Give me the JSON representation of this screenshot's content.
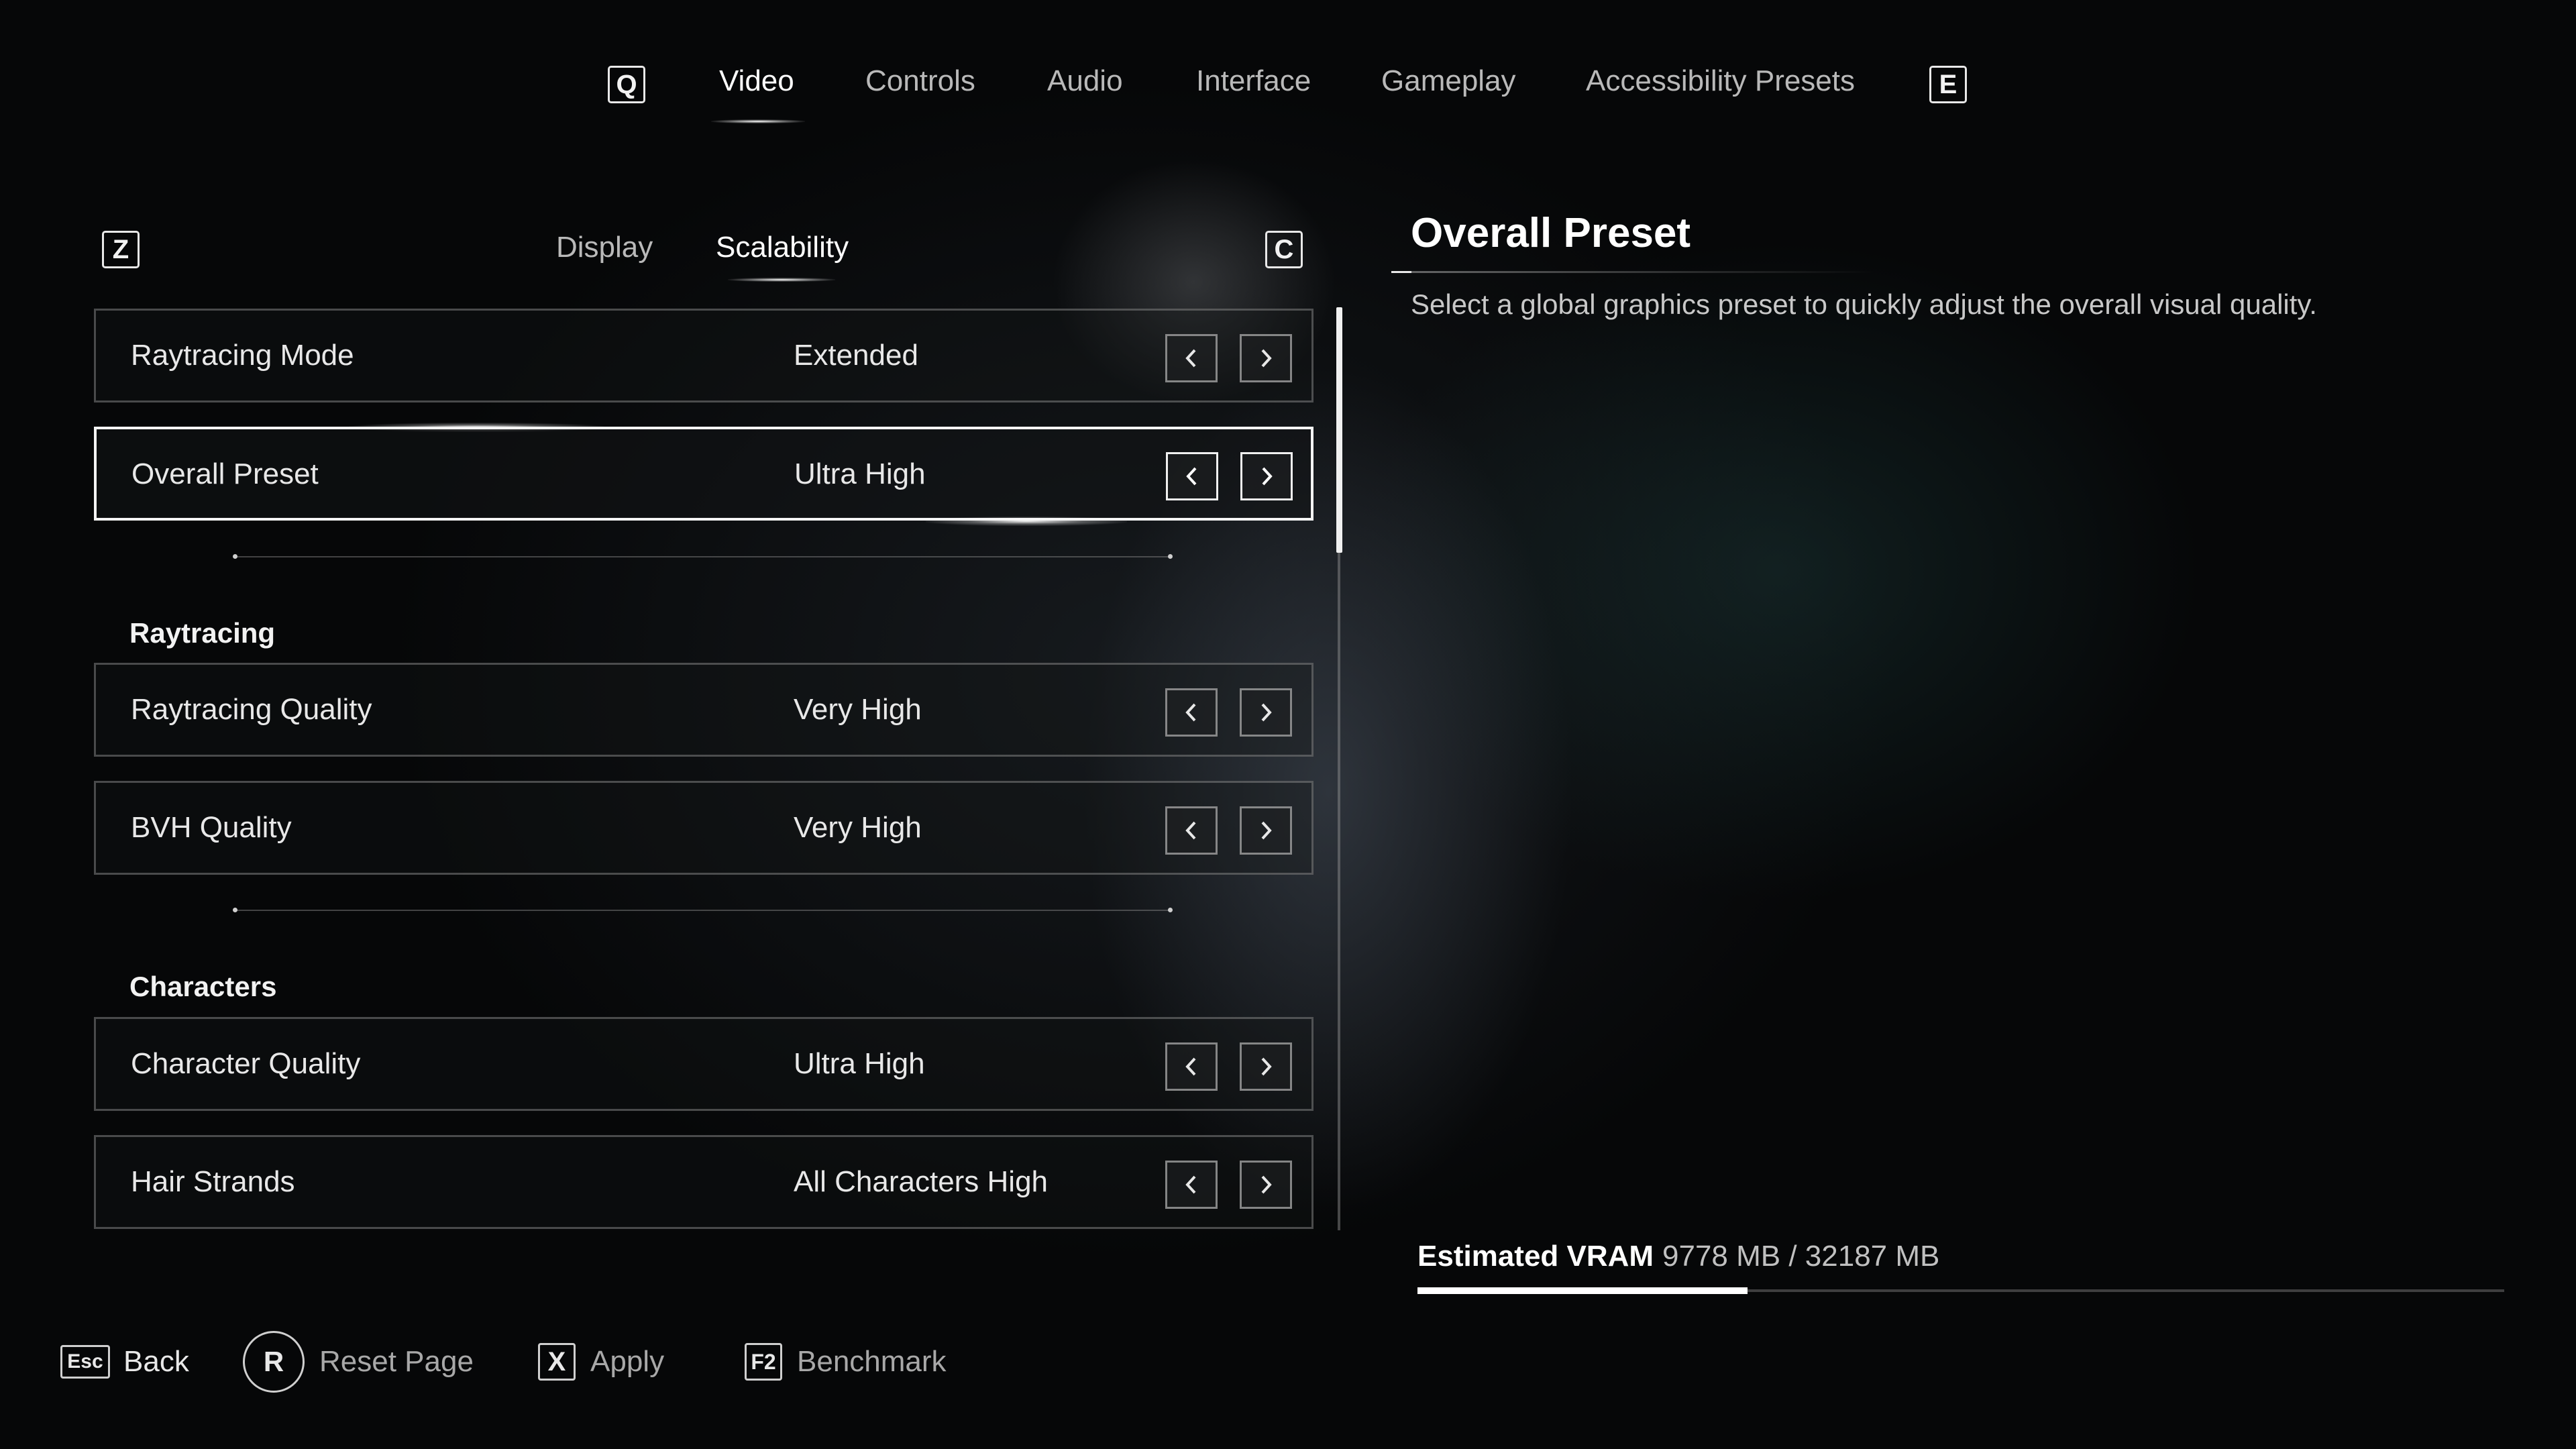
{
  "top_nav": {
    "prev_key": "Q",
    "next_key": "E",
    "tabs": [
      {
        "label": "Video",
        "active": true
      },
      {
        "label": "Controls",
        "active": false
      },
      {
        "label": "Audio",
        "active": false
      },
      {
        "label": "Interface",
        "active": false
      },
      {
        "label": "Gameplay",
        "active": false
      },
      {
        "label": "Accessibility Presets",
        "active": false
      }
    ]
  },
  "sub_nav": {
    "prev_key": "Z",
    "next_key": "C",
    "tabs": [
      {
        "label": "Display",
        "active": false
      },
      {
        "label": "Scalability",
        "active": true
      }
    ]
  },
  "settings": {
    "raytracing_mode": {
      "label": "Raytracing Mode",
      "value": "Extended"
    },
    "overall_preset": {
      "label": "Overall Preset",
      "value": "Ultra High",
      "selected": true
    },
    "raytracing_header": "Raytracing",
    "raytracing_quality": {
      "label": "Raytracing Quality",
      "value": "Very High"
    },
    "bvh_quality": {
      "label": "BVH Quality",
      "value": "Very High"
    },
    "characters_header": "Characters",
    "character_quality": {
      "label": "Character Quality",
      "value": "Ultra High"
    },
    "hair_strands": {
      "label": "Hair Strands",
      "value": "All Characters High"
    }
  },
  "detail": {
    "title": "Overall Preset",
    "description": "Select a global graphics preset to quickly adjust the overall visual quality."
  },
  "vram": {
    "label": "Estimated VRAM",
    "value": "9778 MB / 32187 MB",
    "used_mb": 9778,
    "total_mb": 32187
  },
  "footer": {
    "back": {
      "key": "Esc",
      "label": "Back"
    },
    "reset": {
      "key": "R",
      "label": "Reset Page"
    },
    "apply": {
      "key": "X",
      "label": "Apply"
    },
    "benchmark": {
      "key": "F2",
      "label": "Benchmark"
    }
  },
  "icons": {
    "arrow_left": "chevron-left-icon",
    "arrow_right": "chevron-right-icon"
  },
  "colors": {
    "accent": "#ffffff",
    "text": "#e8e8e8",
    "muted": "#b9b9b9",
    "background": "#060708"
  }
}
